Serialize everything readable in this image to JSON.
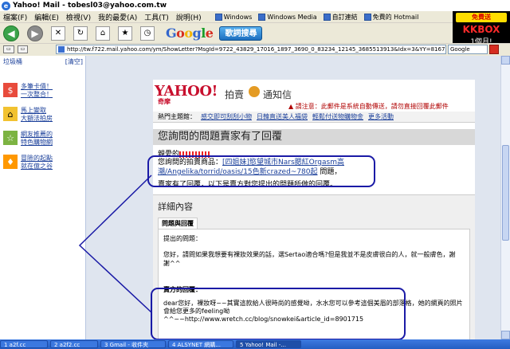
{
  "window": {
    "title": "Yahoo! Mail - tobesl03@yahoo.com.tw"
  },
  "menu": [
    "檔案(F)",
    "編輯(E)",
    "檢視(V)",
    "我的最愛(A)",
    "工具(T)",
    "說明(H)"
  ],
  "links": [
    "Windows",
    "Windows Media",
    "自訂連結",
    "免費的 Hotmail"
  ],
  "ad": {
    "free": "免費送",
    "brand": "KKBOX",
    "month": "1個月!"
  },
  "toolbar": {
    "google": "Google",
    "song": "歌詞搜尋"
  },
  "address": {
    "url": "http://tw.f722.mail.yahoo.com/ym/ShowLetter?MsgId=9722_43829_17016_1897_3690_0_83234_12145_3685513913&Idx=3&YY=81677&inc=25&ord",
    "search": "Google"
  },
  "sidebar": {
    "top_left": "垃圾桶",
    "top_right": "[清空]",
    "items": [
      "多筆卡債！\n一次整合！",
      "馬上變取\n大額法拍房",
      "網友推薦的\n特色購物網",
      "冒險的起點\n就在億之谷"
    ]
  },
  "yahoo": {
    "logo": "YAHOO!",
    "kimo": "奇摩",
    "auction": "拍賣",
    "notice": "通知信",
    "warning": "請注意：此郵件是系統自動傳送，請勿直接回覆此郵件",
    "hot_label": "熱門主題館：",
    "hot_links": [
      "感交即可刮刮小物",
      "日韓直送美人福袋",
      "輕鬆付送物購物金",
      "更多活動"
    ]
  },
  "message": {
    "title": "您詢問的問題賣家有了回覆",
    "greeting": "親愛的",
    "item_prefix": "您詢問的拍賣商品：",
    "item_link": "[四姐妹]慾望城市Nars腮紅Orgasm高潮/Angelika/torrid/oasis/15色新crazed~780起",
    "item_suffix": " 問題，",
    "reply_line": "賣家有了回覆，以下是賣方對您提出的問題所做的回覆。"
  },
  "detail": {
    "title": "詳細內容",
    "tab": "問題與回覆",
    "q_label": "提出的問題：",
    "question": "您好，請問如果我想要有裸妝效果的話，選Sertao適合嗎?但是我並不是皮膚很白的人，就一般膚色，謝謝^^",
    "a_label": "賣方的回覆：",
    "answer": "dear您好，裸妝呀~~其實這款給人很時尚的感覺呦，水水您可以參考這個美眉的部落格，她的網頁的照片會給您更多的feeling呦\n^^~~http://www.wretch.cc/blog/snowkei&article_id=8901715"
  },
  "taskbar": [
    "1 a2f.cc",
    "2 a2f2.cc",
    "3 Gmail - 收件夾",
    "4 ALSYNET 網購...",
    "5 Yahoo! Mail -..."
  ]
}
